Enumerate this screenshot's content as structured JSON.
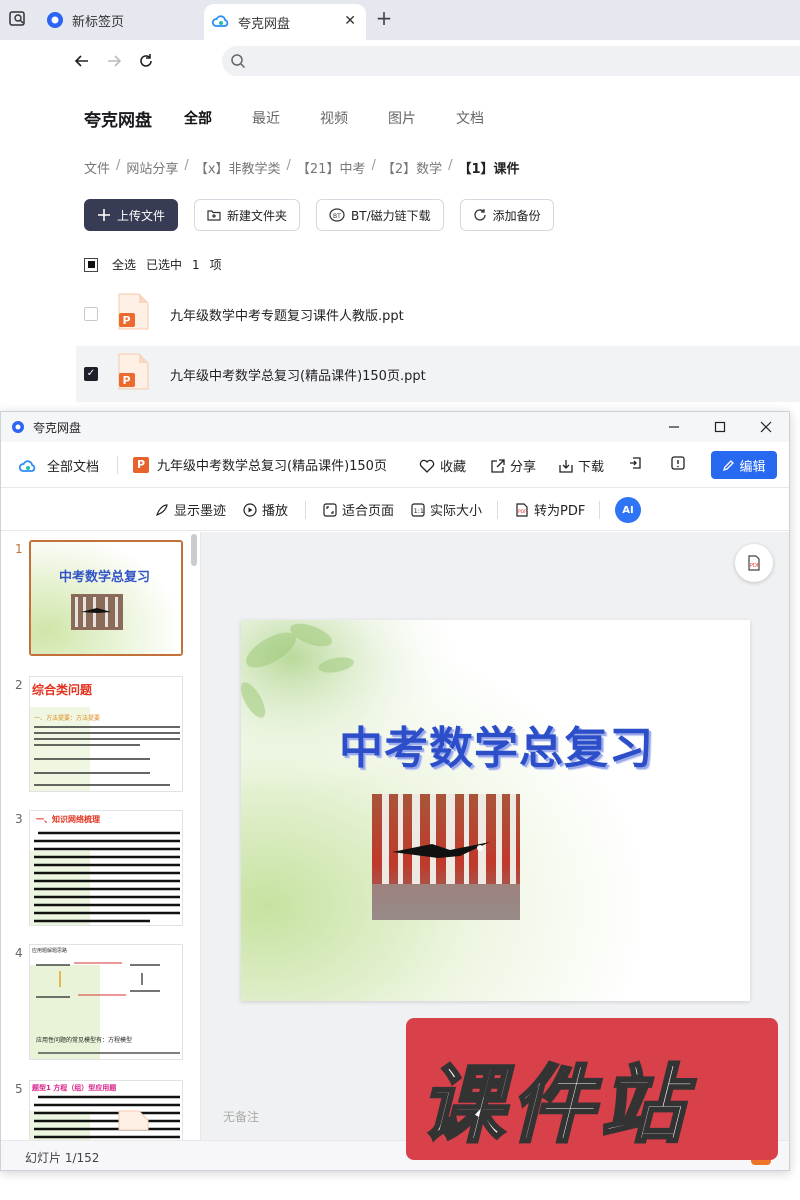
{
  "browser": {
    "tabs": [
      {
        "label": "新标签页",
        "icon": "browser-logo-icon"
      },
      {
        "label": "夸克网盘",
        "icon": "quark-cloud-icon"
      }
    ],
    "new_tab_symbol": "+",
    "close_symbol": "✕"
  },
  "drive": {
    "brand": "夸克网盘",
    "nav": [
      "全部",
      "最近",
      "视频",
      "图片",
      "文档"
    ],
    "active_nav": "全部",
    "breadcrumb": [
      "文件",
      "网站分享",
      "【x】非教学类",
      "【21】中考",
      "【2】数学",
      "【1】课件"
    ],
    "breadcrumb_sep": "/",
    "actions": {
      "upload": "上传文件",
      "new_folder": "新建文件夹",
      "bt": "BT/磁力链下载",
      "backup": "添加备份"
    },
    "selection": {
      "select_all": "全选",
      "selected_prefix": "已选中",
      "count": "1",
      "unit": "项"
    },
    "files": [
      {
        "name": "九年级数学中考专题复习课件人教版.ppt",
        "checked": false
      },
      {
        "name": "九年级中考数学总复习(精品课件)150页.ppt",
        "checked": true
      }
    ]
  },
  "viewer": {
    "window_title": "夸克网盘",
    "all_docs": "全部文档",
    "doc_title": "九年级中考数学总复习(精品课件)150页",
    "file_badge": "P",
    "header_buttons": {
      "favorite": "收藏",
      "share": "分享",
      "download": "下载",
      "edit": "编辑"
    },
    "tools": {
      "ink": "显示墨迹",
      "play": "播放",
      "fit_page": "适合页面",
      "actual_size": "实际大小",
      "to_pdf": "转为PDF",
      "ai": "AI"
    },
    "thumbnails": [
      {
        "num": "1",
        "title": "中考数学总复习"
      },
      {
        "num": "2",
        "title": "综合类问题",
        "subtitle": "一、方法提要：方法提要"
      },
      {
        "num": "3",
        "title": "一、知识网络梳理"
      },
      {
        "num": "4",
        "title": "应用题解题思路",
        "caption": "应用性问题的常见模型有：方程模型"
      },
      {
        "num": "5",
        "title": "题型1 方程（组）型应用题"
      }
    ],
    "slide": {
      "title": "中考数学总复习"
    },
    "notes": "无备注",
    "status": "幻灯片 1/152"
  },
  "watermark": "课件站",
  "colors": {
    "accent": "#2769f0",
    "selected_thumb": "#c4703a",
    "upload_bg": "#383b54",
    "watermark_red": "#d8404a"
  }
}
